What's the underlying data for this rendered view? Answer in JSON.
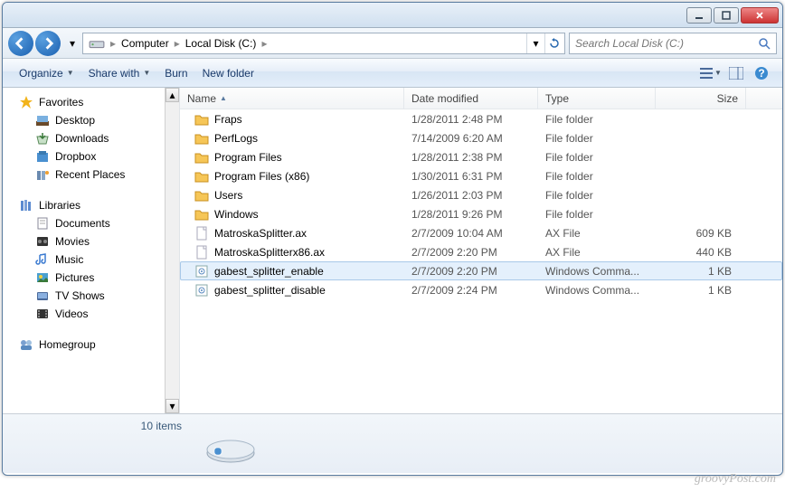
{
  "breadcrumb": {
    "seg1": "Computer",
    "seg2": "Local Disk (C:)"
  },
  "search": {
    "placeholder": "Search Local Disk (C:)"
  },
  "toolbar": {
    "organize": "Organize",
    "share": "Share with",
    "burn": "Burn",
    "newfolder": "New folder"
  },
  "sidebar": {
    "favorites": {
      "label": "Favorites",
      "items": [
        "Desktop",
        "Downloads",
        "Dropbox",
        "Recent Places"
      ]
    },
    "libraries": {
      "label": "Libraries",
      "items": [
        "Documents",
        "Movies",
        "Music",
        "Pictures",
        "TV Shows",
        "Videos"
      ]
    },
    "homegroup": {
      "label": "Homegroup"
    }
  },
  "columns": {
    "name": "Name",
    "date": "Date modified",
    "type": "Type",
    "size": "Size"
  },
  "files": [
    {
      "icon": "folder",
      "name": "Fraps",
      "date": "1/28/2011 2:48 PM",
      "type": "File folder",
      "size": ""
    },
    {
      "icon": "folder",
      "name": "PerfLogs",
      "date": "7/14/2009 6:20 AM",
      "type": "File folder",
      "size": ""
    },
    {
      "icon": "folder",
      "name": "Program Files",
      "date": "1/28/2011 2:38 PM",
      "type": "File folder",
      "size": ""
    },
    {
      "icon": "folder",
      "name": "Program Files (x86)",
      "date": "1/30/2011 6:31 PM",
      "type": "File folder",
      "size": ""
    },
    {
      "icon": "folder",
      "name": "Users",
      "date": "1/26/2011 2:03 PM",
      "type": "File folder",
      "size": ""
    },
    {
      "icon": "folder",
      "name": "Windows",
      "date": "1/28/2011 9:26 PM",
      "type": "File folder",
      "size": ""
    },
    {
      "icon": "file",
      "name": "MatroskaSplitter.ax",
      "date": "2/7/2009 10:04 AM",
      "type": "AX File",
      "size": "609 KB"
    },
    {
      "icon": "file",
      "name": "MatroskaSplitterx86.ax",
      "date": "2/7/2009 2:20 PM",
      "type": "AX File",
      "size": "440 KB"
    },
    {
      "icon": "cmd",
      "name": "gabest_splitter_enable",
      "date": "2/7/2009 2:20 PM",
      "type": "Windows Comma...",
      "size": "1 KB",
      "selected": true
    },
    {
      "icon": "cmd",
      "name": "gabest_splitter_disable",
      "date": "2/7/2009 2:24 PM",
      "type": "Windows Comma...",
      "size": "1 KB"
    }
  ],
  "status": {
    "count": "10 items"
  },
  "watermark": "groovyPost.com"
}
